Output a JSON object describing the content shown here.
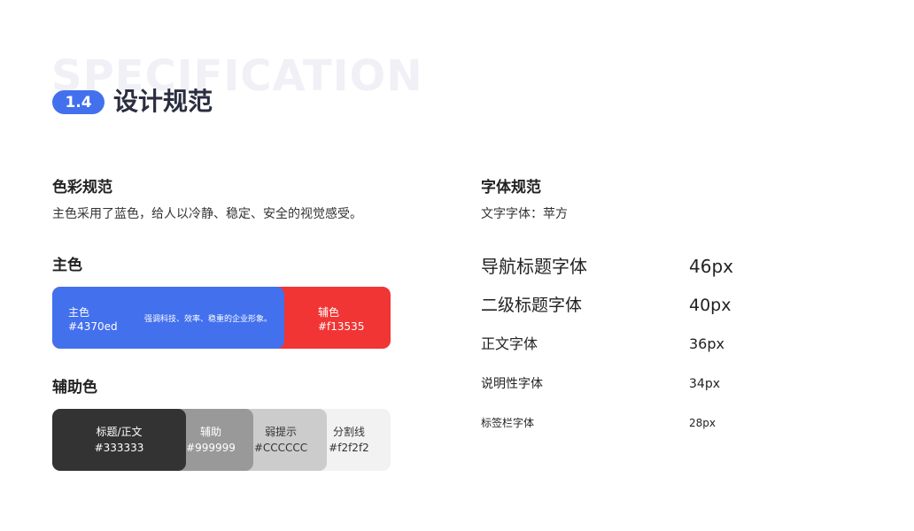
{
  "header": {
    "watermark": "SPECIFICATION",
    "badge": "1.4",
    "title": "设计规范"
  },
  "color_spec": {
    "title": "色彩规范",
    "description": "主色采用了蓝色，给人以冷静、稳定、安全的视觉感受。"
  },
  "primary": {
    "title": "主色",
    "main": {
      "label": "主色",
      "hex": "#4370ed"
    },
    "note": "强调科技、效率、稳重的企业形象。",
    "secondary": {
      "label": "辅色",
      "hex": "#f13535"
    }
  },
  "auxiliary": {
    "title": "辅助色",
    "swatches": [
      {
        "label": "标题/正文",
        "hex": "#333333"
      },
      {
        "label": "辅助",
        "hex": "#999999"
      },
      {
        "label": "弱提示",
        "hex": "#CCCCCC"
      },
      {
        "label": "分割线",
        "hex": "#f2f2f2"
      }
    ]
  },
  "font_spec": {
    "title": "字体规范",
    "description": "文字字体：苹方",
    "rows": [
      {
        "name": "导航标题字体",
        "size": "46px"
      },
      {
        "name": "二级标题字体",
        "size": "40px"
      },
      {
        "name": "正文字体",
        "size": "36px"
      },
      {
        "name": "说明性字体",
        "size": "34px"
      },
      {
        "name": "标签栏字体",
        "size": "28px"
      }
    ]
  },
  "colors": {
    "primary": "#4370ed",
    "secondary": "#f13535",
    "text": "#333333",
    "assist": "#999999",
    "weak": "#CCCCCC",
    "divider": "#f2f2f2"
  }
}
